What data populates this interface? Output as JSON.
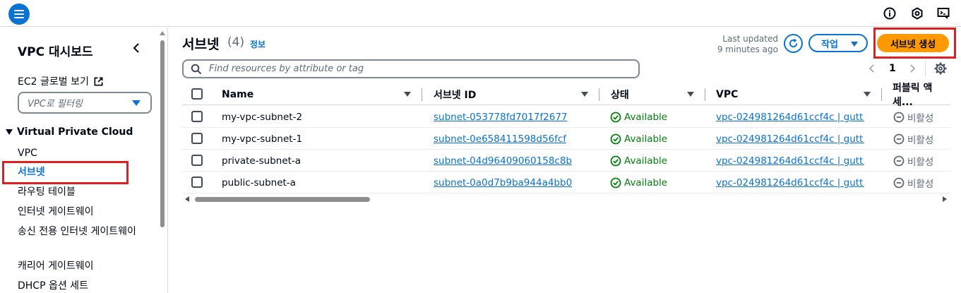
{
  "topbar": {
    "icons": [
      "menu-icon",
      "info-icon",
      "notifications-icon",
      "cloudshell-icon"
    ]
  },
  "sidebar": {
    "title": "VPC 대시보드",
    "ec2_link": "EC2 글로벌 보기",
    "filter_placeholder": "VPC로 필터링",
    "section": "Virtual Private Cloud",
    "items": [
      {
        "label": "VPC"
      },
      {
        "label": "서브넷"
      },
      {
        "label": "라우팅 테이블"
      },
      {
        "label": "인터넷 게이트웨이"
      },
      {
        "label": "송신 전용 인터넷 게이트웨이"
      },
      {
        "label": "캐리어 게이트웨이"
      },
      {
        "label": "DHCP 옵션 세트"
      }
    ]
  },
  "main": {
    "title": "서브넷",
    "count": "(4)",
    "info": "정보",
    "last_updated_line1": "Last updated",
    "last_updated_line2": "9 minutes ago",
    "action_label": "작업",
    "create_label": "서브넷 생성",
    "search_placeholder": "Find resources by attribute or tag",
    "page": "1"
  },
  "table": {
    "columns": [
      "Name",
      "서브넷 ID",
      "상태",
      "VPC",
      "퍼블릭 액세..."
    ],
    "rows": [
      {
        "name": "my-vpc-subnet-2",
        "id": "subnet-053778fd7017f2677",
        "state": "Available",
        "vpc": "vpc-024981264d61ccf4c | gutt...",
        "public": "비활성"
      },
      {
        "name": "my-vpc-subnet-1",
        "id": "subnet-0e658411598d56fcf",
        "state": "Available",
        "vpc": "vpc-024981264d61ccf4c | gutt...",
        "public": "비활성"
      },
      {
        "name": "private-subnet-a",
        "id": "subnet-04d96409060158c8b",
        "state": "Available",
        "vpc": "vpc-024981264d61ccf4c | gutt...",
        "public": "비활성"
      },
      {
        "name": "public-subnet-a",
        "id": "subnet-0a0d7b9ba944a4bb0",
        "state": "Available",
        "vpc": "vpc-024981264d61ccf4c | gutt...",
        "public": "비활성"
      }
    ]
  },
  "colors": {
    "accent": "#0972d3",
    "primary_button": "#ff9900",
    "success": "#037f0c",
    "highlight_box": "#e02020"
  }
}
